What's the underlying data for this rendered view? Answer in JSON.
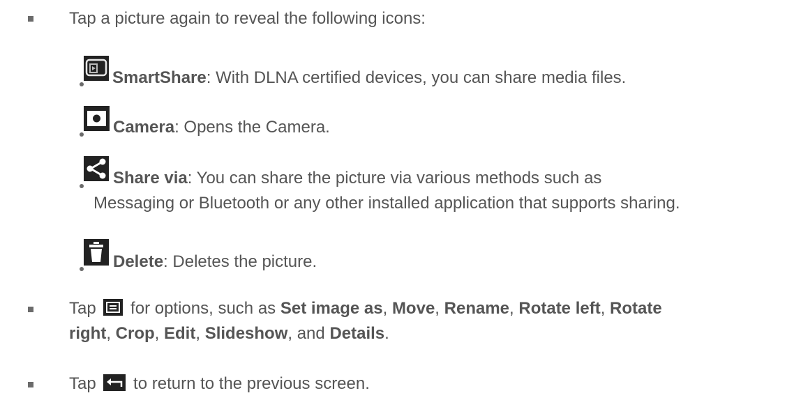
{
  "bullet1": {
    "text": "Tap a picture again to reveal the following icons:"
  },
  "icons": [
    {
      "icon": "smartshare-icon",
      "name": "SmartShare",
      "desc": ": With DLNA certified devices, you can share media files."
    },
    {
      "icon": "camera-icon",
      "name": "Camera",
      "desc": ": Opens the Camera."
    },
    {
      "icon": "share-icon",
      "name": "Share via",
      "desc": ": You can share the picture via various methods such as",
      "desc2": "Messaging or Bluetooth or any other installed application that supports sharing."
    },
    {
      "icon": "delete-icon",
      "name": "Delete",
      "desc": ": Deletes the picture."
    }
  ],
  "bullet2": {
    "tap": "Tap",
    "text1": "for options, such as",
    "o1": "Set image as",
    "c1": ",",
    "o2": "Move",
    "c2": ",",
    "o3": "Rename",
    "c3": ",",
    "o4": "Rotate left",
    "c4": ",",
    "o5": "Rotate",
    "o5b": "right",
    "c5": ",",
    "o6": "Crop",
    "c6": ",",
    "o7": "Edit",
    "c7": ",",
    "o8": "Slideshow",
    "c8": ", and",
    "o9": "Details",
    "c9": "."
  },
  "bullet3": {
    "tap": "Tap",
    "text": "to return to the previous screen."
  },
  "colors": {
    "text": "#555555",
    "bullet": "#6b6b6b",
    "icon": "#222222"
  }
}
